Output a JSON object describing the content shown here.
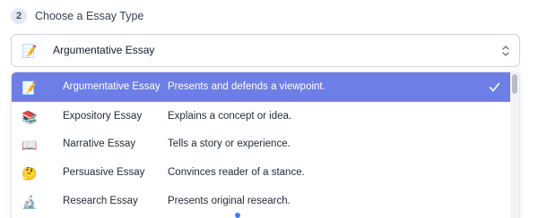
{
  "step": {
    "number": "2",
    "label": "Choose a Essay Type"
  },
  "select": {
    "icon": "📝",
    "icon_name": "memo-icon",
    "value": "Argumentative Essay"
  },
  "options": [
    {
      "icon": "📝",
      "icon_name": "memo-icon",
      "name": "Argumentative Essay",
      "description": "Presents and defends a viewpoint.",
      "selected": true
    },
    {
      "icon": "📚",
      "icon_name": "books-icon",
      "name": "Expository Essay",
      "description": "Explains a concept or idea.",
      "selected": false
    },
    {
      "icon": "📖",
      "icon_name": "open-book-icon",
      "name": "Narrative Essay",
      "description": "Tells a story or experience.",
      "selected": false
    },
    {
      "icon": "🤔",
      "icon_name": "thinking-face-icon",
      "name": "Persuasive Essay",
      "description": "Convinces reader of a stance.",
      "selected": false
    },
    {
      "icon": "🔬",
      "icon_name": "microscope-icon",
      "name": "Research Essay",
      "description": "Presents original research.",
      "selected": false
    }
  ],
  "colors": {
    "selected_bg": "#6d7fe6",
    "step_badge_bg": "#e4e7f6"
  }
}
